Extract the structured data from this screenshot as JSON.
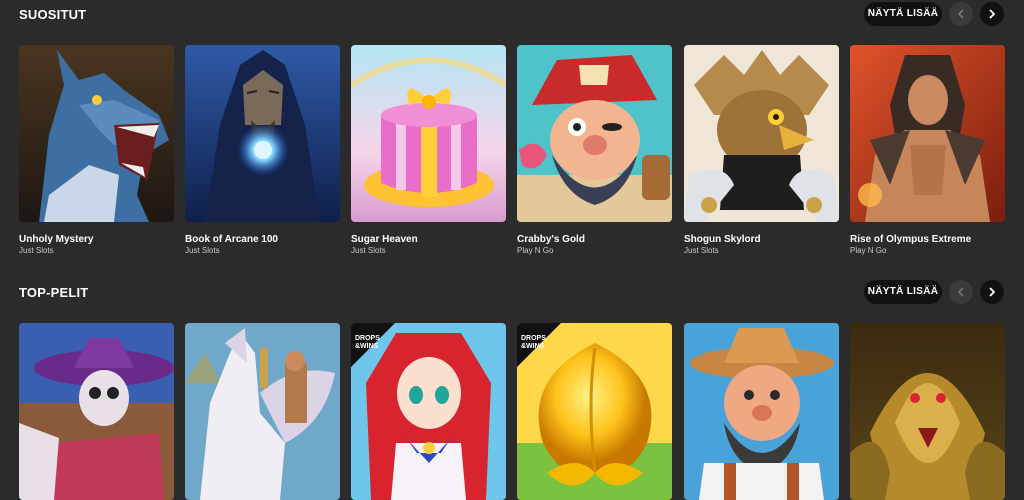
{
  "sections": [
    {
      "title": "SUOSITUT",
      "show_more": "NÄYTÄ LISÄÄ",
      "games": [
        {
          "title": "Unholy Mystery",
          "provider": "Just Slots",
          "art_icon": "werewolf-art"
        },
        {
          "title": "Book of Arcane 100",
          "provider": "Just Slots",
          "art_icon": "wizard-art"
        },
        {
          "title": "Sugar Heaven",
          "provider": "Just Slots",
          "art_icon": "gift-box-art"
        },
        {
          "title": "Crabby's Gold",
          "provider": "Play N Go",
          "art_icon": "pirate-art"
        },
        {
          "title": "Shogun Skylord",
          "provider": "Just Slots",
          "art_icon": "eagle-warrior-art"
        },
        {
          "title": "Rise of Olympus Extreme",
          "provider": "Play N Go",
          "art_icon": "hooded-warrior-art"
        }
      ]
    },
    {
      "title": "TOP-PELIT",
      "show_more": "NÄYTÄ LISÄÄ",
      "games": [
        {
          "art_icon": "skeleton-mariachi-art"
        },
        {
          "art_icon": "pegasus-art"
        },
        {
          "art_icon": "anime-girl-art",
          "badge": "DROPS & WINS"
        },
        {
          "art_icon": "golden-peach-art",
          "badge": "DROPS & WINS"
        },
        {
          "art_icon": "cowboy-art"
        },
        {
          "art_icon": "cobra-art"
        }
      ]
    }
  ],
  "colors": {
    "background": "#2b2b2b",
    "button_dark": "#111111",
    "button_disabled": "#3a3a3a",
    "provider_text": "#c9c9c9"
  }
}
